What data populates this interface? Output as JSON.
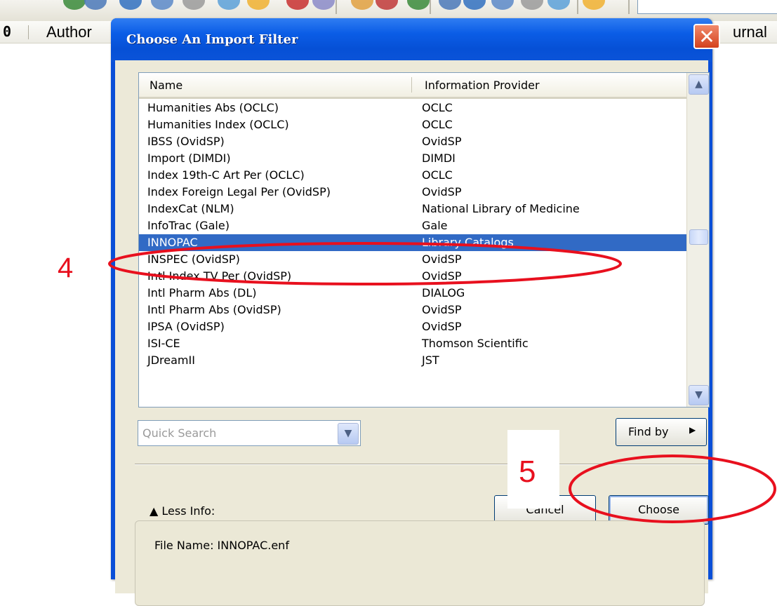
{
  "app": {
    "toolbar_colors": [
      "#3a8a3a",
      "#4a78b8",
      "#3070c0",
      "#5a88c8",
      "#9a9a9a",
      "#5aa0d8",
      "#f0b030",
      "#c83030",
      "#8a8ac8",
      "#e0a040",
      "#c03838"
    ],
    "columns": {
      "clip_icon": "paperclip-icon",
      "clip_glyph": "0",
      "author": "Author",
      "journal_partial": "urnal"
    }
  },
  "dialog": {
    "title": "Choose An Import Filter",
    "close_glyph": "✕",
    "list": {
      "headers": {
        "name": "Name",
        "provider": "Information Provider"
      },
      "rows": [
        {
          "name": "Humanities Abs (OCLC)",
          "provider": "OCLC"
        },
        {
          "name": "Humanities Index (OCLC)",
          "provider": "OCLC"
        },
        {
          "name": "IBSS (OvidSP)",
          "provider": "OvidSP"
        },
        {
          "name": "Import (DIMDI)",
          "provider": "DIMDI"
        },
        {
          "name": "Index 19th-C Art Per (OCLC)",
          "provider": "OCLC"
        },
        {
          "name": "Index Foreign Legal Per (OvidSP)",
          "provider": "OvidSP"
        },
        {
          "name": "IndexCat (NLM)",
          "provider": "National Library of Medicine"
        },
        {
          "name": "InfoTrac (Gale)",
          "provider": "Gale"
        },
        {
          "name": "INNOPAC",
          "provider": "Library Catalogs",
          "selected": true
        },
        {
          "name": "INSPEC (OvidSP)",
          "provider": "OvidSP"
        },
        {
          "name": "Intl Index TV Per (OvidSP)",
          "provider": "OvidSP"
        },
        {
          "name": "Intl Pharm Abs (DL)",
          "provider": "DIALOG"
        },
        {
          "name": "Intl Pharm Abs (OvidSP)",
          "provider": "OvidSP"
        },
        {
          "name": "IPSA (OvidSP)",
          "provider": "OvidSP"
        },
        {
          "name": "ISI-CE",
          "provider": "Thomson Scientific"
        },
        {
          "name": "JDreamII",
          "provider": "JST"
        }
      ],
      "scroll_up_glyph": "▲",
      "scroll_down_glyph": "▼"
    },
    "quick_search": {
      "placeholder": "Quick Search",
      "arrow_glyph": "▼"
    },
    "find_by": {
      "label": "Find by",
      "arrow_glyph": "▶"
    },
    "less_info": {
      "arrow_glyph": "▲",
      "label": "Less Info:"
    },
    "buttons": {
      "cancel": "Cancel",
      "choose": "Choose"
    },
    "file_name": "File Name:  INNOPAC.enf"
  },
  "annotations": {
    "step4": "4",
    "step5": "5",
    "color": "#e8101e"
  }
}
